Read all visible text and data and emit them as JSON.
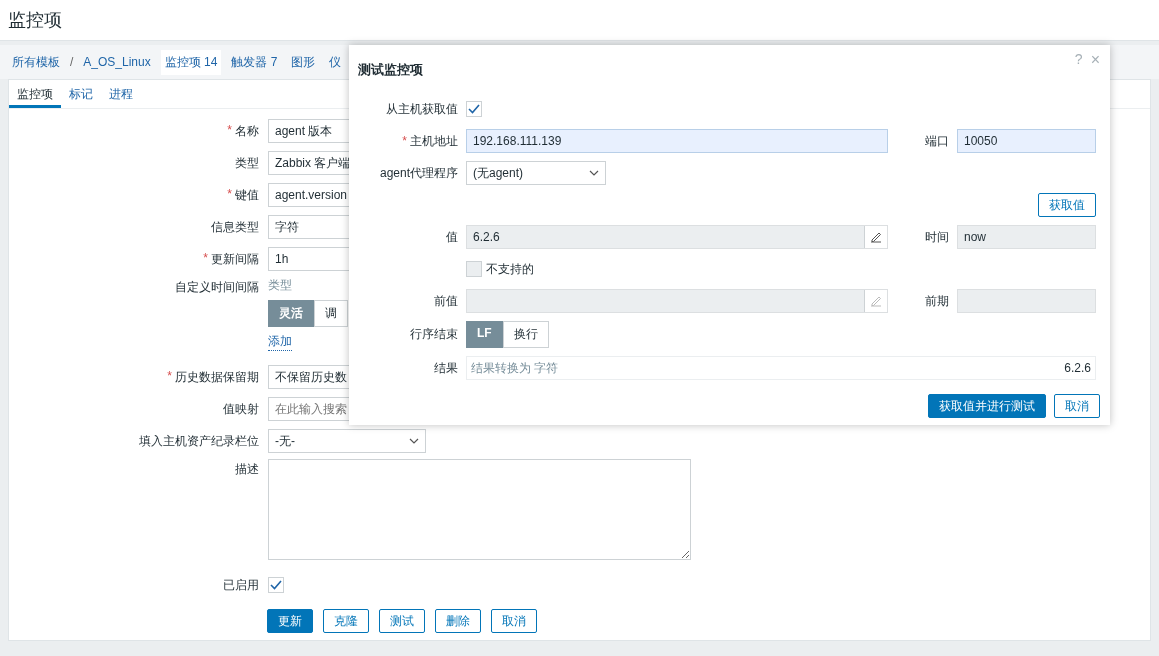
{
  "page": {
    "title": "监控项"
  },
  "breadcrumb": [
    {
      "label": "所有模板",
      "selected": false
    },
    {
      "kind": "separator",
      "label": "/"
    },
    {
      "label": "A_OS_Linux",
      "selected": false
    },
    {
      "label": "监控项 14",
      "selected": true
    },
    {
      "label": "触发器 7",
      "selected": false
    },
    {
      "label": "图形",
      "selected": false
    },
    {
      "label": "仪",
      "selected": false
    }
  ],
  "tabs": [
    {
      "label": "监控项",
      "selected": true
    },
    {
      "label": "标记",
      "selected": false
    },
    {
      "label": "进程",
      "selected": false
    }
  ],
  "form": {
    "fields": [
      {
        "kind": "text",
        "asterisk": "*",
        "label": "名称",
        "value": "agent 版本"
      },
      {
        "kind": "text",
        "label": "类型",
        "value": "Zabbix 客户端"
      },
      {
        "kind": "text",
        "asterisk": "*",
        "label": "键值",
        "value": "agent.version"
      },
      {
        "kind": "text",
        "label": "信息类型",
        "value": "字符"
      },
      {
        "kind": "text",
        "asterisk": "*",
        "label": "更新间隔",
        "value": "1h"
      },
      {
        "kind": "intervals",
        "label": "自定义时间间隔",
        "header": "类型",
        "options": [
          {
            "label": "灵活",
            "selected": true
          },
          {
            "label": "调",
            "selected": false
          }
        ],
        "link": "添加"
      },
      {
        "kind": "text",
        "asterisk": "*",
        "label": "历史数据保留期",
        "value": "不保留历史数"
      },
      {
        "kind": "search",
        "label": "值映射",
        "placeholder": "在此输入搜索"
      },
      {
        "kind": "select",
        "label": "填入主机资产纪录栏位",
        "value": "-无-"
      },
      {
        "kind": "textarea",
        "label": "描述"
      },
      {
        "kind": "checkbox",
        "label": "已启用",
        "checked": true
      }
    ],
    "buttons": [
      {
        "label": "更新",
        "kind": "primary"
      },
      {
        "label": "克隆",
        "kind": "secondary"
      },
      {
        "label": "测试",
        "kind": "secondary"
      },
      {
        "label": "删除",
        "kind": "secondary"
      },
      {
        "label": "取消",
        "kind": "secondary"
      }
    ]
  },
  "dialog": {
    "title": "测试监控项",
    "help": "?",
    "close": "×",
    "get_from_host": {
      "label": "从主机获取值",
      "checked": true
    },
    "host": {
      "asterisk": "*",
      "label": "主机地址",
      "value": "192.168.111.139"
    },
    "port": {
      "label": "端口",
      "value": "10050"
    },
    "proxy": {
      "label": "agent代理程序",
      "value": "(无agent)"
    },
    "get_value_button": "获取值",
    "value": {
      "label": "值",
      "value": "6.2.6"
    },
    "time": {
      "label": "时间",
      "value": "now"
    },
    "not_supported": {
      "label": "不支持的",
      "checked": false
    },
    "prev_value": {
      "label": "前值"
    },
    "prev_time": {
      "label": "前期"
    },
    "eol": {
      "label": "行序结束",
      "options": [
        {
          "label": "LF",
          "selected": true
        },
        {
          "label": "换行",
          "selected": false
        }
      ]
    },
    "result": {
      "label": "结果",
      "note": "结果转换为 字符",
      "value": "6.2.6"
    },
    "buttons": [
      {
        "label": "获取值并进行测试",
        "kind": "primary"
      },
      {
        "label": "取消",
        "kind": "secondary"
      }
    ]
  }
}
